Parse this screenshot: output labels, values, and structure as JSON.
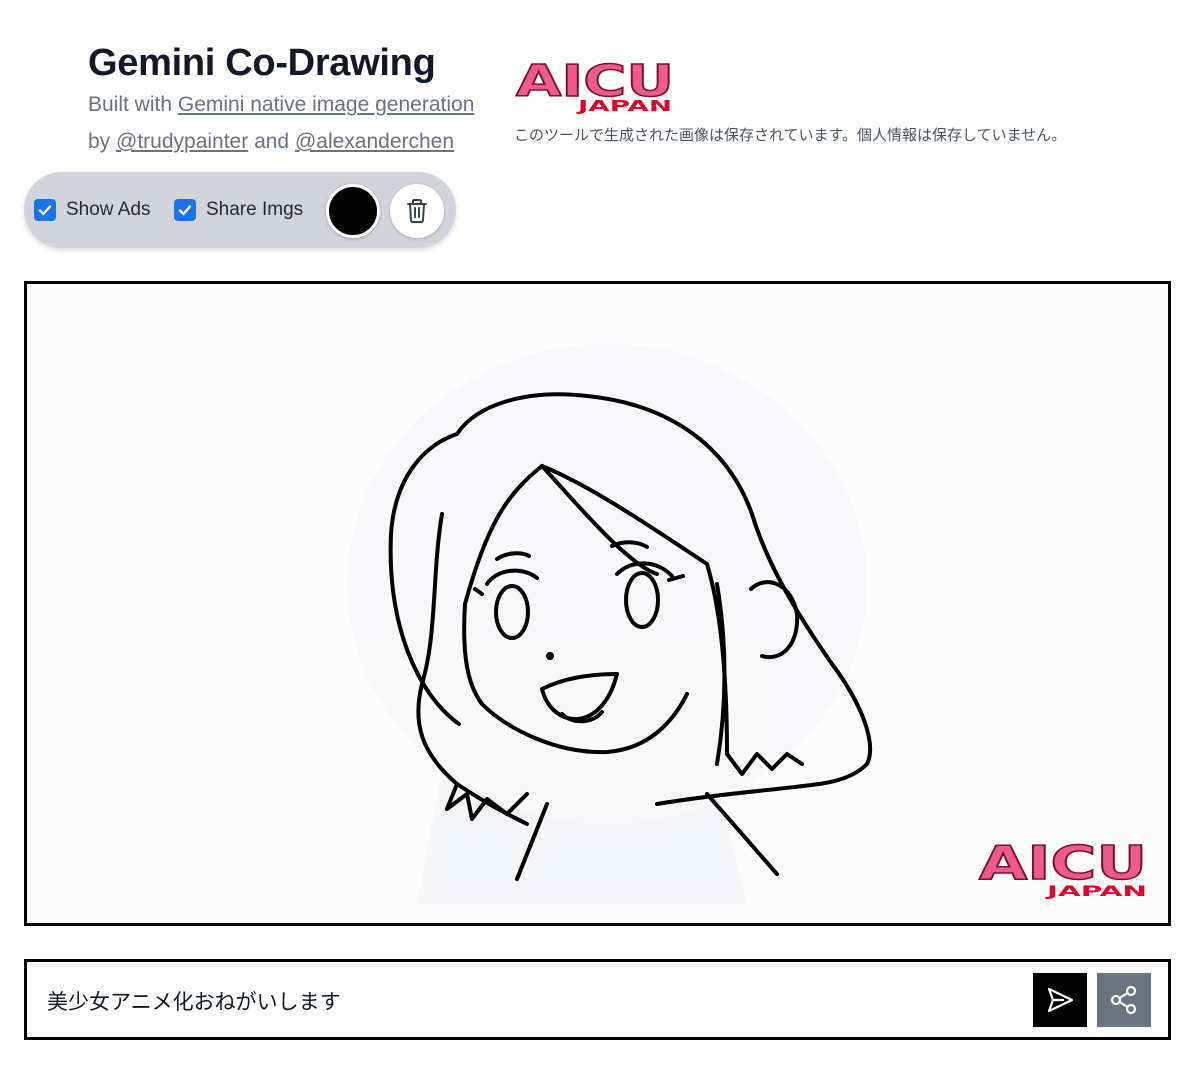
{
  "header": {
    "title": "Gemini Co-Drawing",
    "built_with_prefix": "Built with ",
    "built_with_link": "Gemini native image generation",
    "by_prefix": "by ",
    "author1": "@trudypainter",
    "and_text": " and ",
    "author2": "@alexanderchen"
  },
  "brand": {
    "logo_text_main": "AICU",
    "logo_text_sub": "JAPAN",
    "notice": "このツールで生成された画像は保存されています。個人情報は保存していません。",
    "colors": {
      "logo_pink": "#e8457a",
      "logo_red": "#e0002a"
    }
  },
  "toolbar": {
    "show_ads_label": "Show Ads",
    "show_ads_checked": true,
    "share_imgs_label": "Share Imgs",
    "share_imgs_checked": true,
    "pen_color": "#000000",
    "clear_icon": "trash-icon"
  },
  "canvas": {
    "watermark_main": "AICU",
    "watermark_sub": "JAPAN"
  },
  "prompt": {
    "value": "美少女アニメ化おねがいします",
    "send_icon": "send-icon",
    "share_icon": "share-icon"
  }
}
